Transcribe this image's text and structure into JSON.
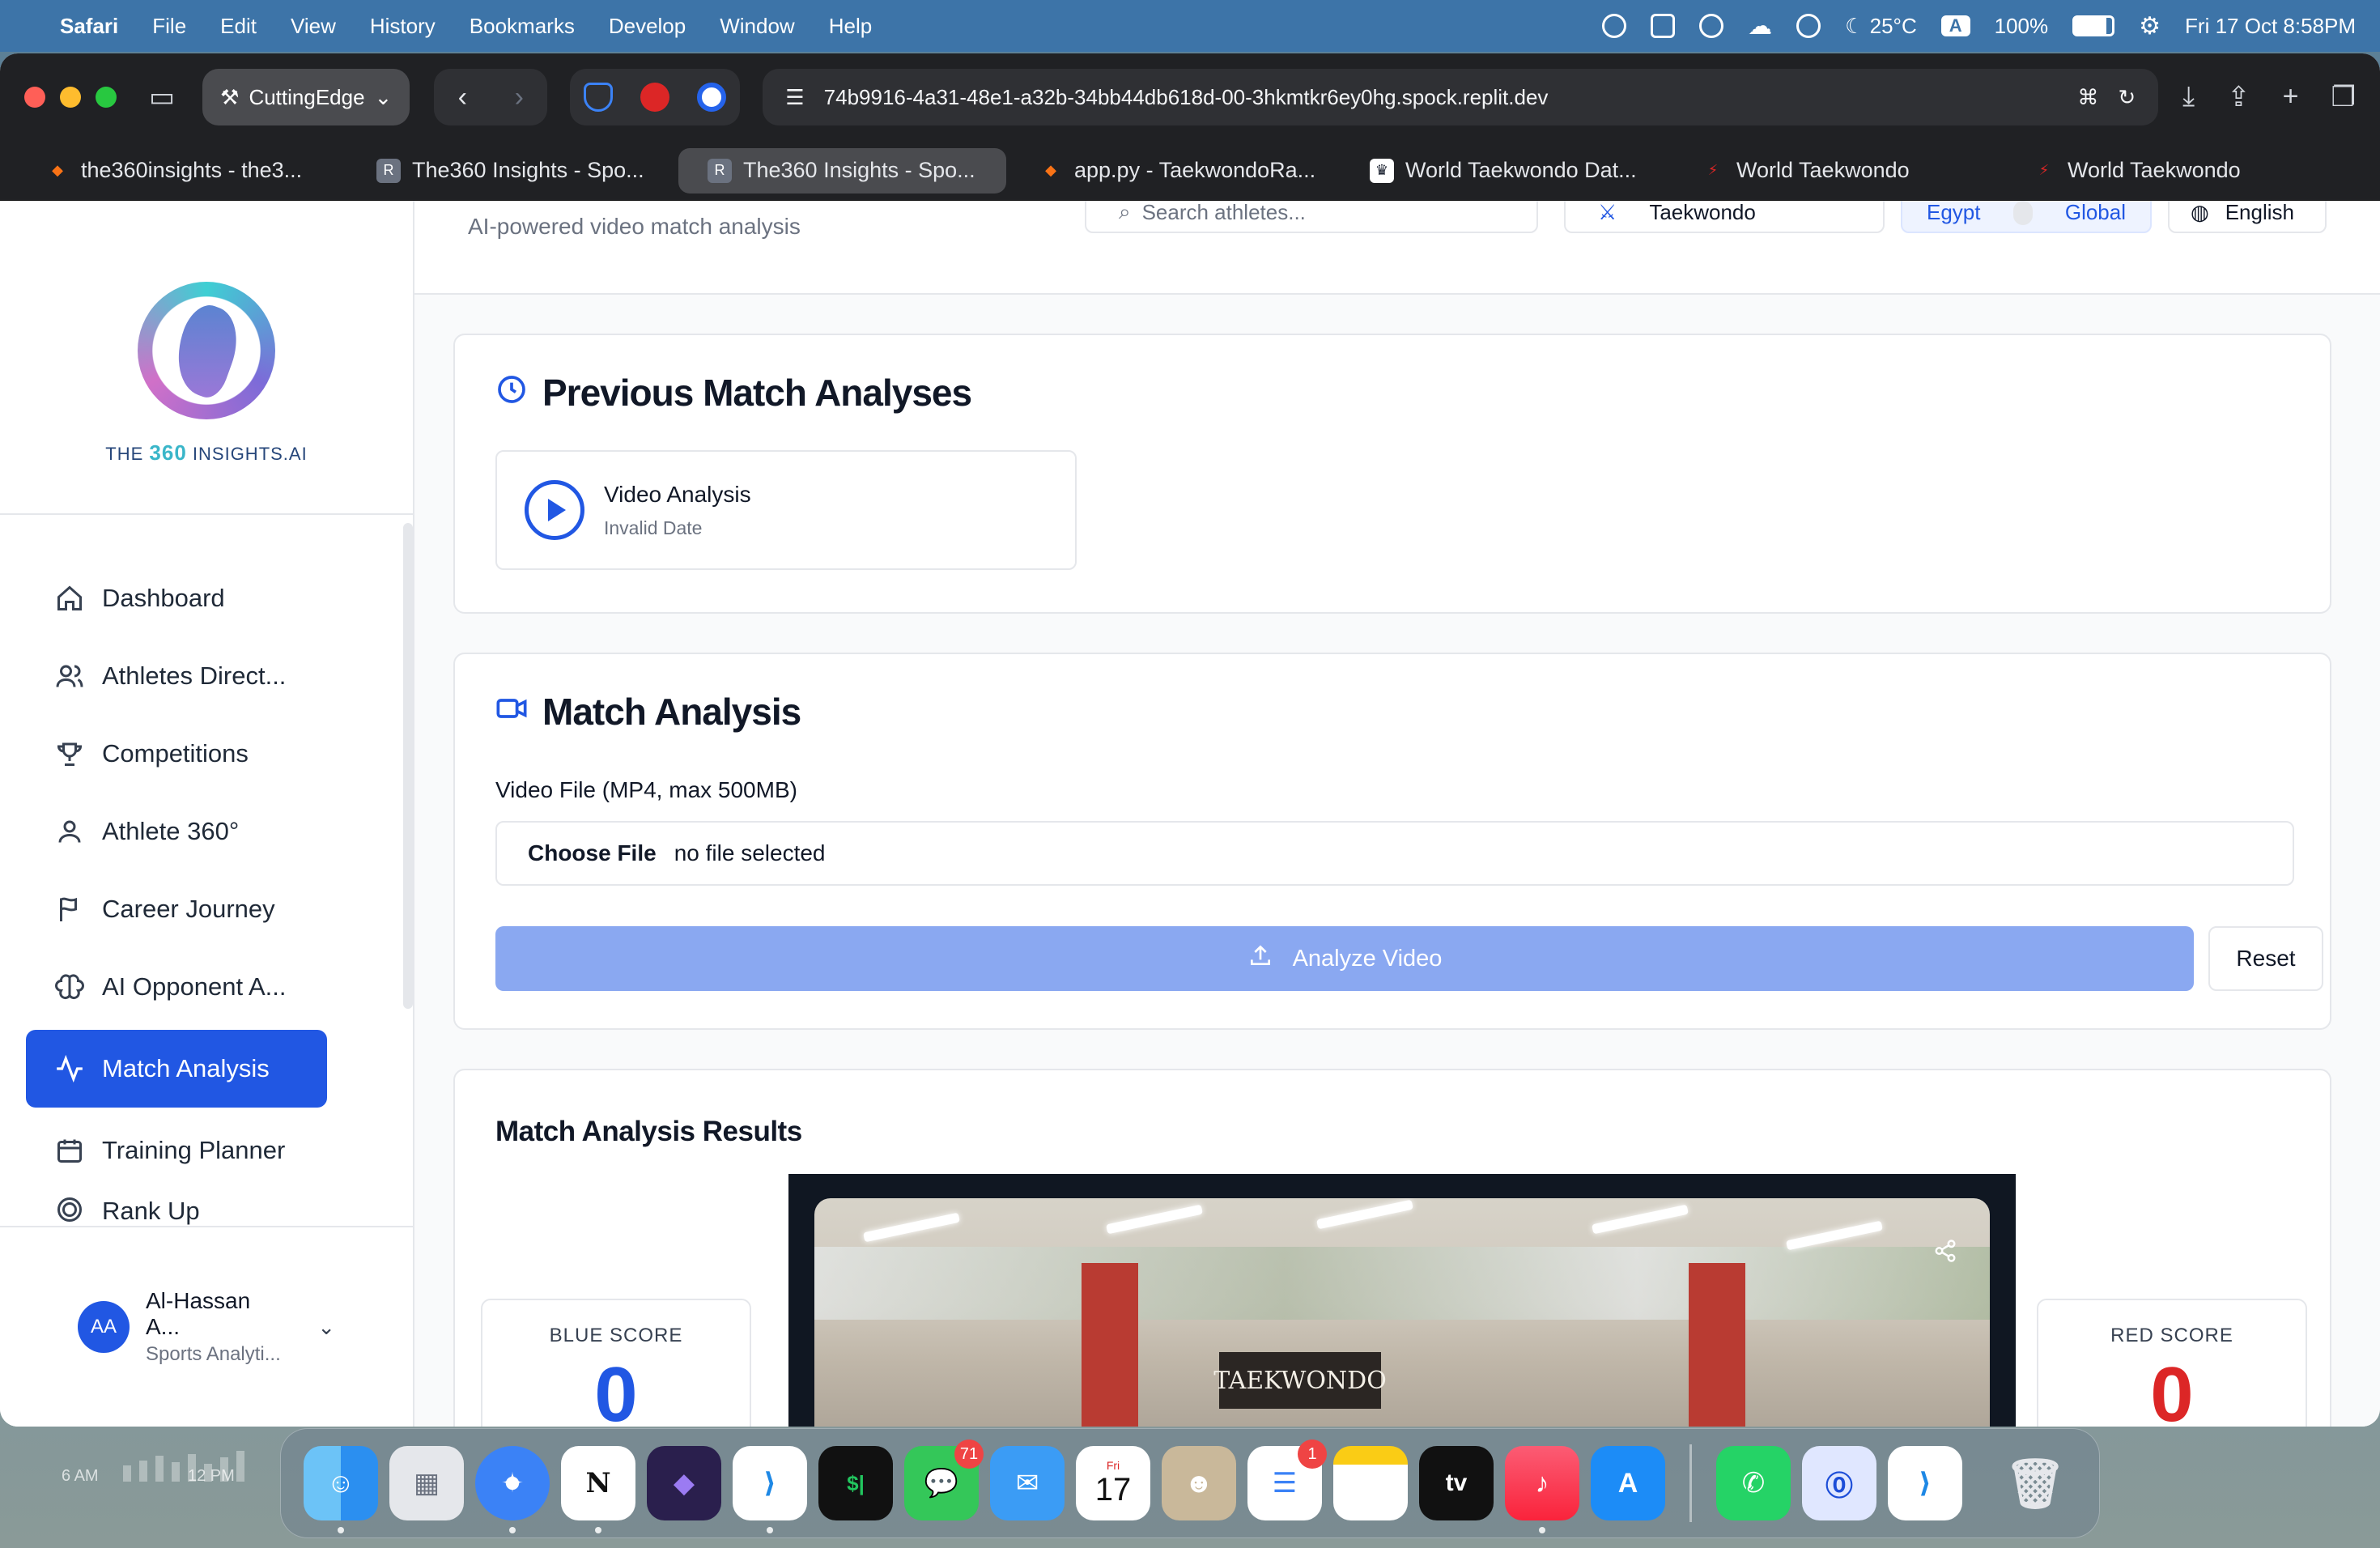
{
  "menubar": {
    "app_name": "Safari",
    "items": [
      "File",
      "Edit",
      "View",
      "History",
      "Bookmarks",
      "Develop",
      "Window",
      "Help"
    ],
    "temperature": "25°C",
    "keyboard": "A",
    "battery": "100%",
    "datetime": "Fri 17 Oct  8:58PM"
  },
  "browser": {
    "profile": "CuttingEdge",
    "url": "74b9916-4a31-48e1-a32b-34bb44db618d-00-3hkmtkr6ey0hg.spock.replit.dev",
    "tabs": [
      {
        "title": "the360insights - the3...",
        "fav": "◆",
        "color": "#f97316"
      },
      {
        "title": "The360 Insights - Spo...",
        "fav": "R",
        "color": "#6b7280"
      },
      {
        "title": "The360 Insights - Spo...",
        "fav": "R",
        "color": "#6b7280"
      },
      {
        "title": "app.py - TaekwondoRa...",
        "fav": "◆",
        "color": "#f97316"
      },
      {
        "title": "World Taekwondo Dat...",
        "fav": "♛",
        "color": "#111827"
      },
      {
        "title": "World Taekwondo",
        "fav": "⚡",
        "color": "#dc2626"
      },
      {
        "title": "World Taekwondo",
        "fav": "⚡",
        "color": "#dc2626"
      }
    ]
  },
  "sidebar": {
    "logo_prefix": "THE ",
    "logo_number": "360",
    "logo_suffix": " INSIGHTS.AI",
    "items": [
      {
        "label": "Dashboard",
        "icon": "home-icon"
      },
      {
        "label": "Athletes Direct...",
        "icon": "users-icon"
      },
      {
        "label": "Competitions",
        "icon": "trophy-icon"
      },
      {
        "label": "Athlete 360°",
        "icon": "user-icon"
      },
      {
        "label": "Career Journey",
        "icon": "flag-icon"
      },
      {
        "label": "AI Opponent A...",
        "icon": "brain-icon"
      },
      {
        "label": "Match Analysis",
        "icon": "activity-icon"
      },
      {
        "label": "Training Planner",
        "icon": "calendar-icon"
      },
      {
        "label": "Rank Up",
        "icon": "target-icon"
      }
    ],
    "user": {
      "initials": "AA",
      "name": "Al-Hassan A...",
      "role": "Sports Analyti..."
    }
  },
  "header": {
    "subtitle": "AI-powered video match analysis",
    "search_placeholder": "Search athletes...",
    "sport": "Taekwondo",
    "toggle_left": "Egypt",
    "toggle_right": "Global",
    "language": "English"
  },
  "previous": {
    "title": "Previous Match Analyses",
    "item_title": "Video Analysis",
    "item_date": "Invalid Date"
  },
  "analysis": {
    "title": "Match Analysis",
    "file_label": "Video File (MP4, max 500MB)",
    "choose_file": "Choose File",
    "file_status": "no file selected",
    "analyze_button": "Analyze Video",
    "reset_button": "Reset"
  },
  "results": {
    "title": "Match Analysis Results",
    "blue_label": "BLUE SCORE",
    "blue_score": "0",
    "red_label": "RED SCORE",
    "red_score": "0",
    "video_banner": "TAEKWONDO"
  },
  "desktop": {
    "label_6am": "6 AM",
    "label_12pm": "12 PM"
  },
  "dock": {
    "messages_badge": "71",
    "reminders_badge": "1",
    "calendar_month": "Fri",
    "calendar_day": "17",
    "tv_label": "tv"
  }
}
